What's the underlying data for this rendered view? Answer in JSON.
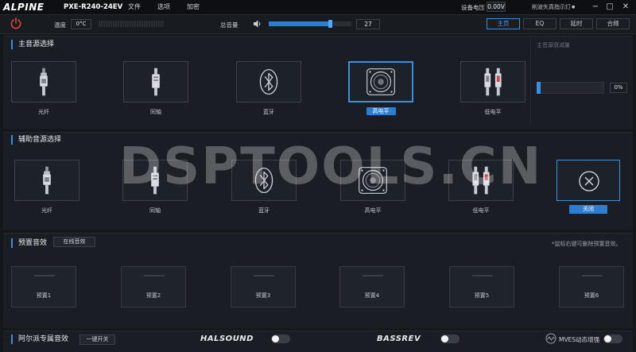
{
  "header": {
    "logo": "ALPINE",
    "model": "PXE-R240-24EV",
    "menu": [
      "文件",
      "选项",
      "加密"
    ],
    "voltage_label": "设备电压",
    "voltage_value": "0.00V",
    "clip_label": "削波失真指示灯",
    "clip_dot": "●"
  },
  "toolbar": {
    "temp_label": "温度",
    "temp_value": "0°C",
    "volume_label": "总音量",
    "volume_value": "27",
    "volume_level_fraction": 0.75,
    "tabs": [
      {
        "label": "主页",
        "active": true
      },
      {
        "label": "EQ",
        "active": false
      },
      {
        "label": "延时",
        "active": false
      },
      {
        "label": "合频",
        "active": false
      }
    ]
  },
  "main_source": {
    "title": "主音源选择",
    "attenuation_label": "主音源衰减量",
    "attenuation_value": "0%",
    "items": [
      {
        "label": "光纤",
        "icon": "optical-icon"
      },
      {
        "label": "同轴",
        "icon": "coaxial-icon"
      },
      {
        "label": "蓝牙",
        "icon": "bluetooth-icon"
      },
      {
        "label": "高电平",
        "icon": "speaker-icon",
        "selected": true
      },
      {
        "label": "低电平",
        "icon": "rca-icon"
      }
    ]
  },
  "aux_source": {
    "title": "辅助音源选择",
    "items": [
      {
        "label": "光纤",
        "icon": "optical-icon"
      },
      {
        "label": "同轴",
        "icon": "coaxial-icon"
      },
      {
        "label": "蓝牙",
        "icon": "bluetooth-icon"
      },
      {
        "label": "高电平",
        "icon": "speaker-icon"
      },
      {
        "label": "低电平",
        "icon": "rca-icon"
      }
    ],
    "close_label": "关闭"
  },
  "presets": {
    "title": "预置音效",
    "online_button": "在线音效",
    "hint": "*鼠标右键可删除预置音效。",
    "items": [
      "预置1",
      "预置2",
      "预置3",
      "预置4",
      "预置5",
      "预置6"
    ]
  },
  "footer": {
    "title": "阿尔派专属音效",
    "one_key": "一键开关",
    "halo_a": "HAL",
    "halo_b": "SOUND",
    "bassrev": "BASSREV",
    "mves": "MVES动态增强"
  },
  "watermark": "DSPTOOLS.CN",
  "colors": {
    "accent": "#3b8fe0",
    "background": "#14171c",
    "panel": "#1a1e24"
  }
}
